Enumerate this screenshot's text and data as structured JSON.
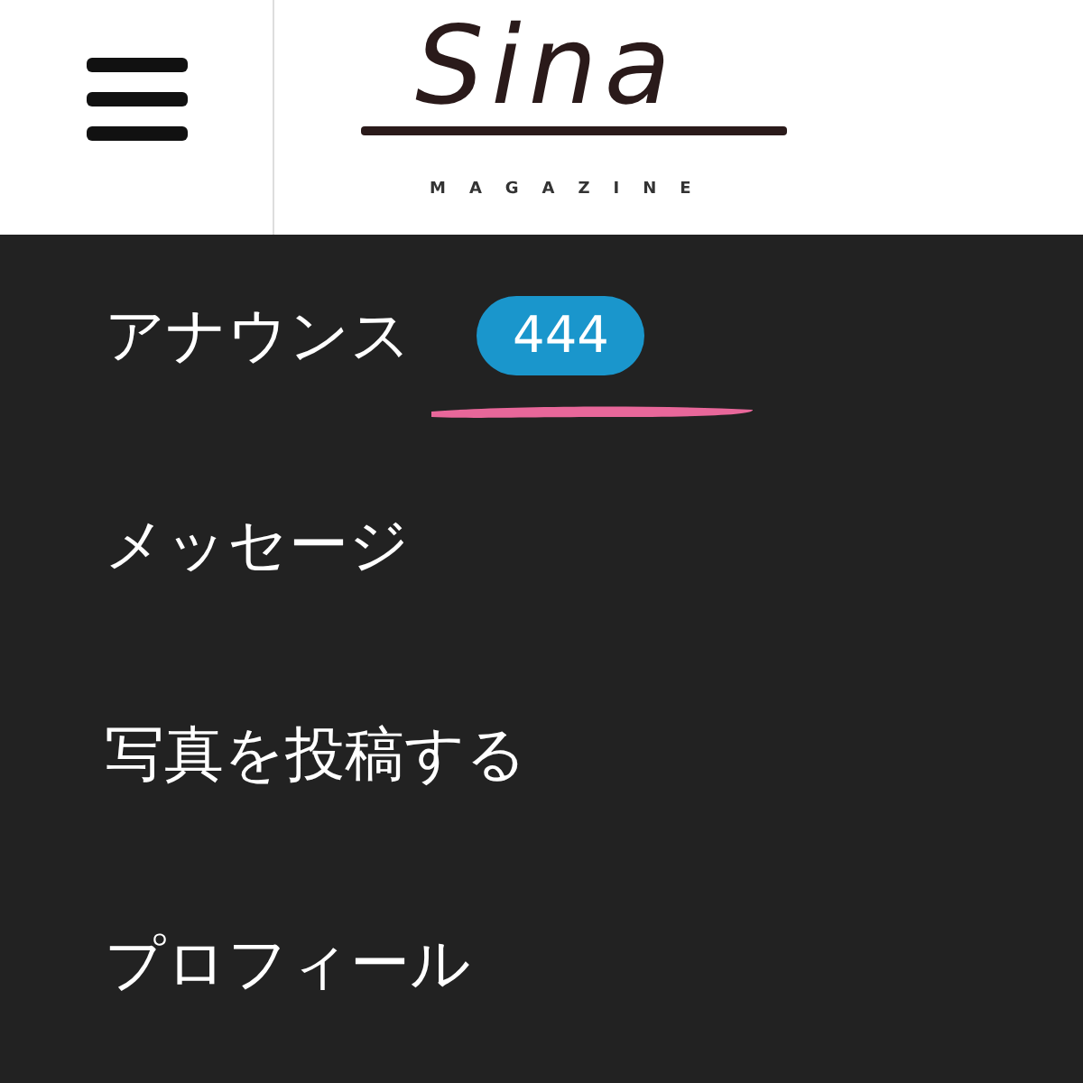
{
  "header": {
    "logo": "Sina",
    "logo_subtitle": "MAGAZINE"
  },
  "menu": [
    {
      "label": "アナウンス",
      "badge": "444"
    },
    {
      "label": "メッセージ"
    },
    {
      "label": "写真を投稿する"
    },
    {
      "label": "プロフィール"
    }
  ]
}
